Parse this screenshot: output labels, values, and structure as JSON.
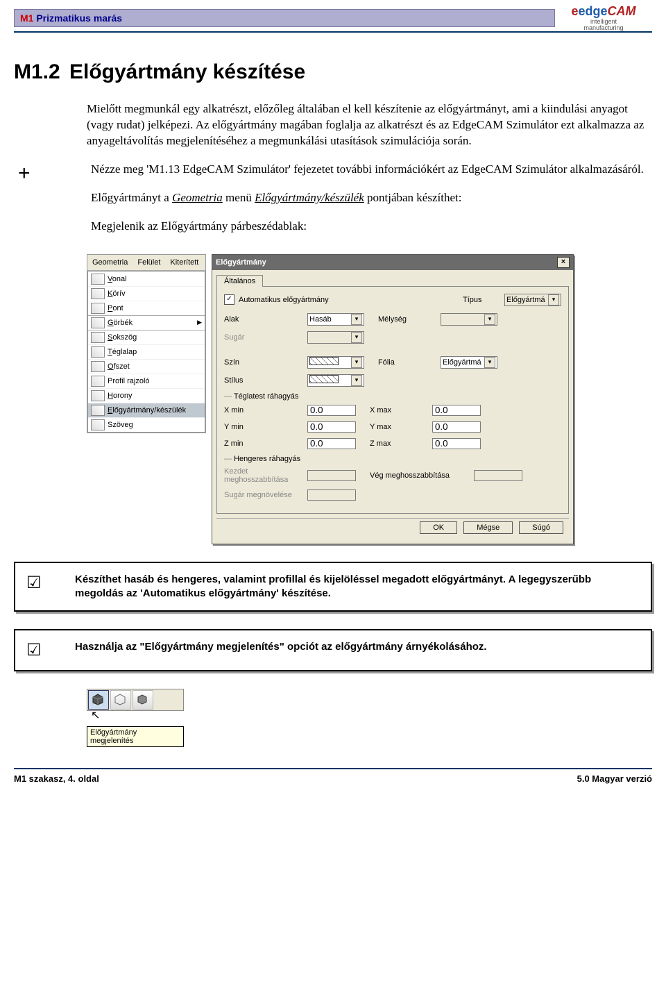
{
  "header": {
    "m1": "M1",
    "title": "Prizmatikus marás",
    "logo_edge": "edge",
    "logo_cam": "CAM",
    "logo_sub1": "intelligent",
    "logo_sub2": "manufacturing"
  },
  "section": {
    "num": "M1.2",
    "title": "Előgyártmány készítése"
  },
  "para1": "Mielőtt megmunkál egy alkatrészt, előzőleg általában el kell készítenie az előgyártmányt, ami a kiindulási anyagot (vagy rudat) jelképezi. Az előgyártmány magában foglalja az alkatrészt és az EdgeCAM Szimulátor ezt alkalmazza az anyageltávolítás megjelenítéséhez a megmunkálási utasítások szimulációja során.",
  "plus_para": "Nézze meg 'M1.13 EdgeCAM Szimulátor' fejezetet további információkért az EdgeCAM Szimulátor alkalmazásáról.",
  "para2_pre": "Előgyártmányt a ",
  "para2_menu1": "Geometria",
  "para2_mid": " menü ",
  "para2_menu2": "Előgyártmány/készülék",
  "para2_post": " pontjában készíthet:",
  "para3": "Megjelenik az Előgyártmány párbeszédablak:",
  "menu": {
    "tabs": [
      "Geometria",
      "Felület",
      "Kiterített"
    ],
    "items": [
      {
        "label": "Vonal",
        "u": "V"
      },
      {
        "label": "Körív",
        "u": "K"
      },
      {
        "label": "Pont",
        "u": "P"
      },
      {
        "label": "Görbék",
        "u": "G",
        "arrow": true,
        "sep": true
      },
      {
        "label": "Sokszög",
        "u": "S",
        "sep": true
      },
      {
        "label": "Téglalap",
        "u": "T"
      },
      {
        "label": "Ofszet",
        "u": "O"
      },
      {
        "label": "Profil rajzoló",
        "u": ""
      },
      {
        "label": "Horony",
        "u": "H"
      },
      {
        "label": "Előgyártmány/készülék",
        "u": "E",
        "sel": true
      },
      {
        "label": "Szöveg",
        "u": ""
      }
    ]
  },
  "dialog": {
    "title": "Előgyártmány",
    "tab": "Általános",
    "auto_chk": "Automatikus előgyártmány",
    "labels": {
      "alak": "Alak",
      "sugar": "Sugár",
      "tipus": "Típus",
      "melyseg": "Mélység",
      "szin": "Szín",
      "stilus": "Stílus",
      "folia": "Fólia",
      "teg": "Téglatest ráhagyás",
      "xmin": "X min",
      "xmax": "X max",
      "ymin": "Y min",
      "ymax": "Y max",
      "zmin": "Z min",
      "zmax": "Z max",
      "heng": "Hengeres ráhagyás",
      "kezd": "Kezdet meghosszabbítása",
      "veg": "Vég meghosszabbítása",
      "sugn": "Sugár megnövelése"
    },
    "values": {
      "alak": "Hasáb",
      "folia": "Előgyártmá",
      "tipus": "Előgyártmá",
      "xmin": "0.0",
      "xmax": "0.0",
      "ymin": "0.0",
      "ymax": "0.0",
      "zmin": "0.0",
      "zmax": "0.0"
    },
    "buttons": {
      "ok": "OK",
      "cancel": "Mégse",
      "help": "Súgó"
    }
  },
  "tip1": "Készíthet hasáb és hengeres, valamint profillal és kijelöléssel megadott előgyártmányt. A legegyszerűbb megoldás az 'Automatikus előgyártmány' készítése.",
  "tip2": "Használja az \"Előgyártmány megjelenítés\" opciót az előgyártmány árnyékolásához.",
  "tooltip": "Előgyártmány megjelenítés",
  "footer": {
    "left": "M1 szakasz, 4. oldal",
    "right": "5.0 Magyar verzió"
  }
}
